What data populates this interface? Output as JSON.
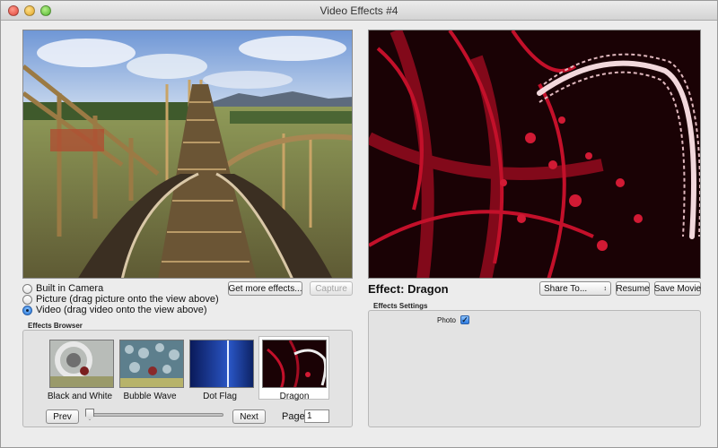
{
  "window": {
    "title": "Video Effects #4"
  },
  "source_options": [
    {
      "label": "Built in Camera",
      "selected": false
    },
    {
      "label": "Picture (drag picture onto the view above)",
      "selected": false
    },
    {
      "label": "Video (drag video onto the view above)",
      "selected": true
    }
  ],
  "buttons": {
    "get_more": "Get more effects...",
    "capture": "Capture",
    "share_to": "Share To...",
    "resume": "Resume",
    "save_movie": "Save Movie",
    "prev": "Prev",
    "next": "Next"
  },
  "effect": {
    "prefix": "Effect:",
    "name": "Dragon"
  },
  "effects_browser": {
    "title": "Effects Browser",
    "items": [
      {
        "label": "Black and White"
      },
      {
        "label": "Bubble Wave"
      },
      {
        "label": "Dot Flag"
      },
      {
        "label": "Dragon",
        "selected": true
      }
    ],
    "page_label": "Page:",
    "page_value": "1"
  },
  "effects_settings": {
    "title": "Effects Settings",
    "photo_label": "Photo",
    "photo_checked": true
  },
  "colors": {
    "accent": "#2c7ae0",
    "dragon_red": "#c3102a"
  }
}
